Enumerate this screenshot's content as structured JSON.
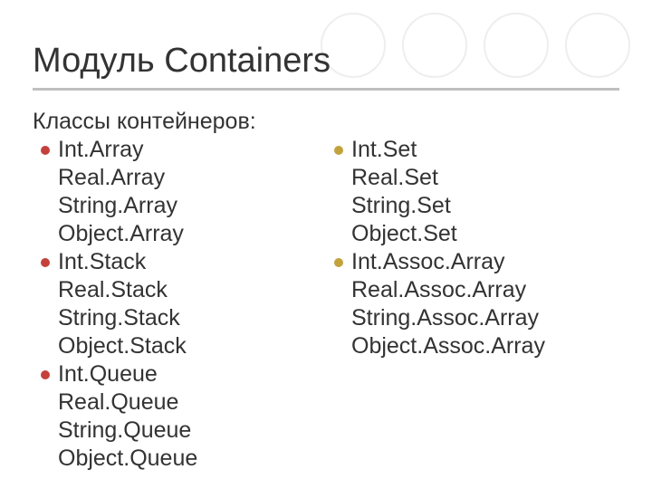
{
  "title": "Модуль Containers",
  "subtitle": "Классы контейнеров:",
  "left_groups": [
    [
      "Int.Array",
      "Real.Array",
      "String.Array",
      "Object.Array"
    ],
    [
      "Int.Stack",
      "Real.Stack",
      "String.Stack",
      "Object.Stack"
    ],
    [
      "Int.Queue",
      "Real.Queue",
      "String.Queue",
      "Object.Queue"
    ]
  ],
  "right_groups": [
    [
      "Int.Set",
      "Real.Set",
      "String.Set",
      "Object.Set"
    ],
    [
      "Int.Assoc.Array",
      "Real.Assoc.Array",
      "String.Assoc.Array",
      "Object.Assoc.Array"
    ]
  ]
}
